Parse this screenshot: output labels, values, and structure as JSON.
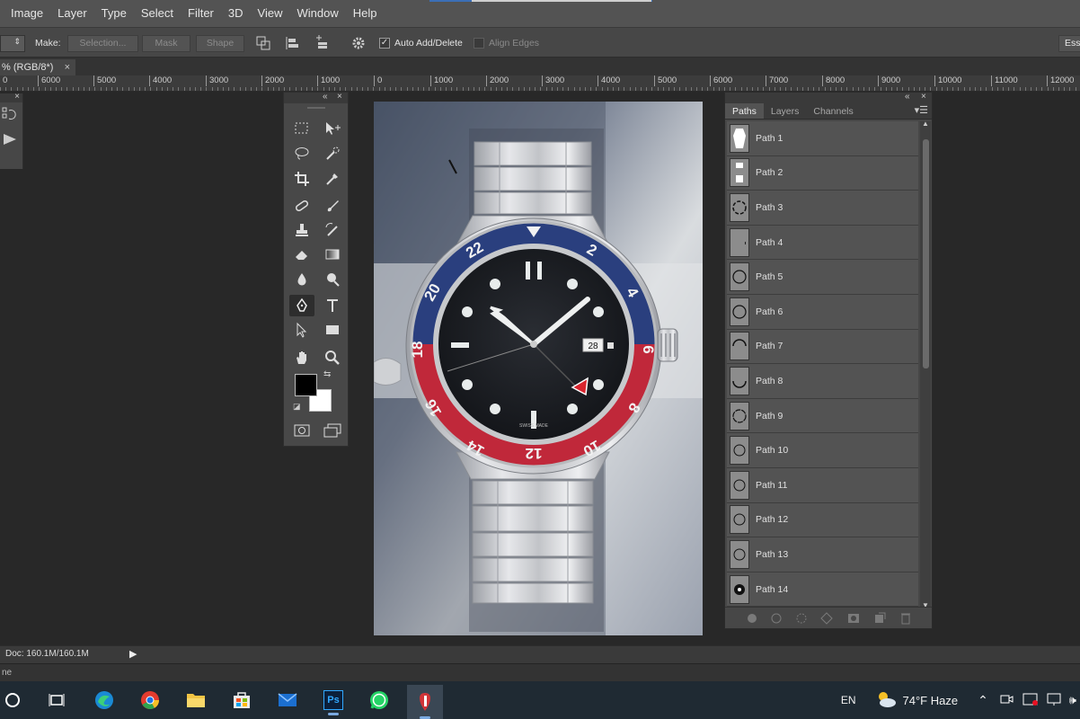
{
  "menu": [
    "Image",
    "Layer",
    "Type",
    "Select",
    "Filter",
    "3D",
    "View",
    "Window",
    "Help"
  ],
  "options": {
    "make_label": "Make:",
    "selection_btn": "Selection...",
    "mask_btn": "Mask",
    "shape_btn": "Shape",
    "auto_add_delete": "Auto Add/Delete",
    "align_edges": "Align Edges",
    "workspace": "Ess"
  },
  "doc_tab": {
    "title": "% (RGB/8*)",
    "close": "×"
  },
  "ruler": [
    "0",
    "6000",
    "5000",
    "4000",
    "3000",
    "2000",
    "1000",
    "0",
    "1000",
    "2000",
    "3000",
    "4000",
    "5000",
    "6000",
    "7000",
    "8000",
    "9000",
    "10000",
    "11000",
    "12000"
  ],
  "paths_panel": {
    "tabs": [
      "Paths",
      "Layers",
      "Channels"
    ],
    "items": [
      "Path 1",
      "Path 2",
      "Path 3",
      "Path 4",
      "Path 5",
      "Path 6",
      "Path 7",
      "Path 8",
      "Path 9",
      "Path 10",
      "Path 11",
      "Path 12",
      "Path 13",
      "Path 14"
    ]
  },
  "status": {
    "doc": "Doc: 160.1M/160.1M",
    "bottom": "ne"
  },
  "watch": {
    "bezel_numbers": [
      "22",
      "2",
      "4",
      "6",
      "8",
      "10",
      "12",
      "14",
      "16",
      "18",
      "20"
    ],
    "date": "28",
    "dial_text": "SWISS      MADE"
  },
  "taskbar": {
    "apps": [
      "start-icon",
      "task-view-icon",
      "edge-icon",
      "chrome-icon",
      "file-explorer-icon",
      "store-icon",
      "mail-icon",
      "photoshop-icon",
      "whatsapp-icon",
      "pin-app-icon"
    ],
    "ps_label": "Ps",
    "language": "EN",
    "weather": "74°F  Haze"
  },
  "colors": {
    "foreground": "#000000",
    "background": "#ffffff",
    "bezel_blue": "#2a3f7e",
    "bezel_red": "#c0283a"
  }
}
